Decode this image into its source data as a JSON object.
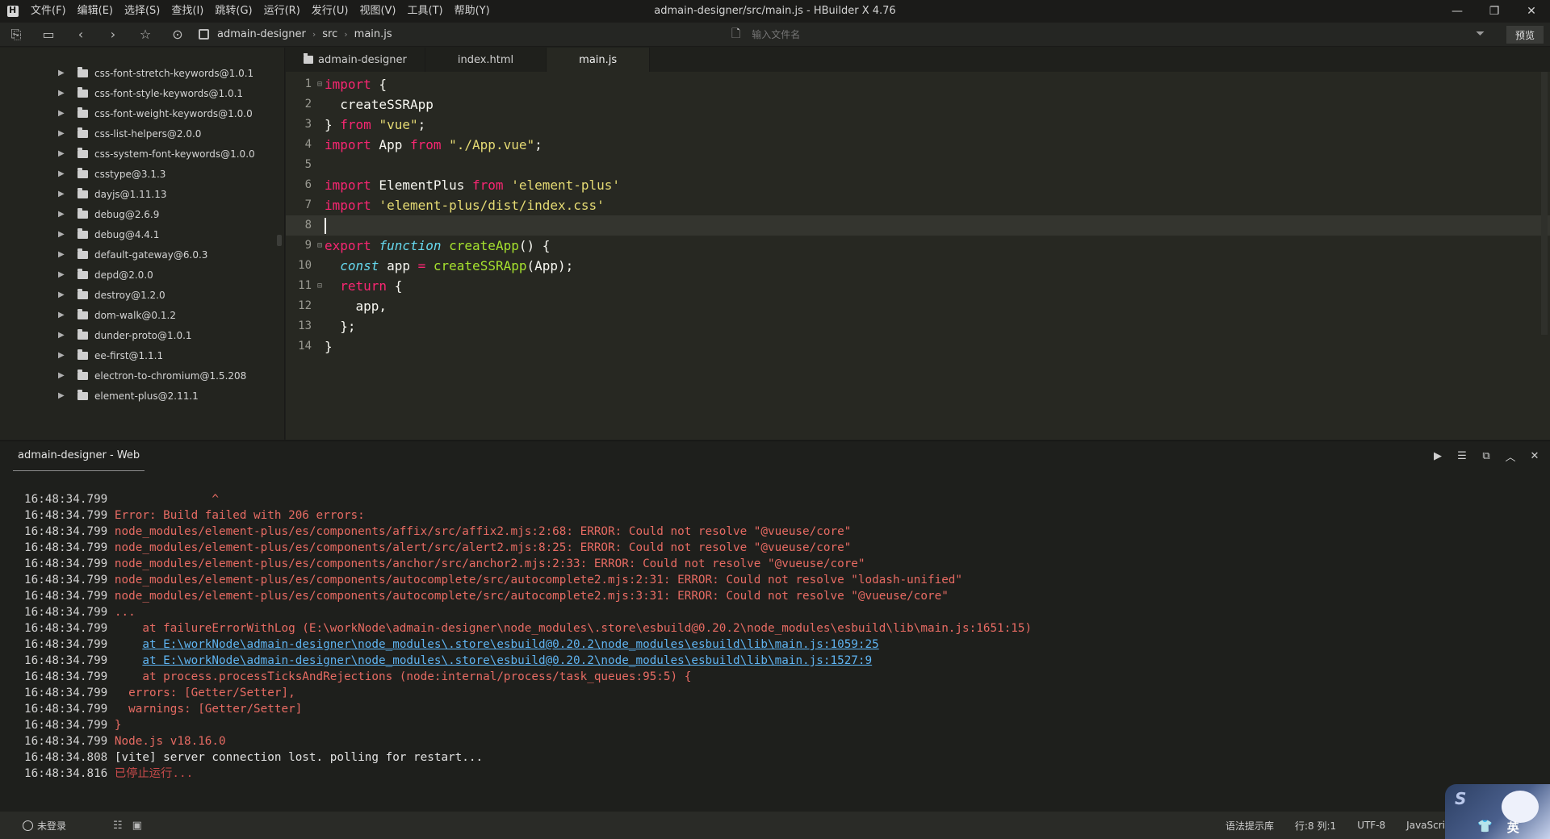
{
  "window": {
    "title": "admain-designer/src/main.js - HBuilder X 4.76",
    "menu": [
      "文件(F)",
      "编辑(E)",
      "选择(S)",
      "查找(I)",
      "跳转(G)",
      "运行(R)",
      "发行(U)",
      "视图(V)",
      "工具(T)",
      "帮助(Y)"
    ],
    "minimize": "—",
    "restore": "❐",
    "close": "✕"
  },
  "toolbar": {
    "breadcrumb": [
      "admain-designer",
      "src",
      "main.js"
    ],
    "search_placeholder": "输入文件名",
    "preview_label": "预览"
  },
  "sidebar": {
    "items": [
      "css-font-stretch-keywords@1.0.1",
      "css-font-style-keywords@1.0.1",
      "css-font-weight-keywords@1.0.0",
      "css-list-helpers@2.0.0",
      "css-system-font-keywords@1.0.0",
      "csstype@3.1.3",
      "dayjs@1.11.13",
      "debug@2.6.9",
      "debug@4.4.1",
      "default-gateway@6.0.3",
      "depd@2.0.0",
      "destroy@1.2.0",
      "dom-walk@0.1.2",
      "dunder-proto@1.0.1",
      "ee-first@1.1.1",
      "electron-to-chromium@1.5.208",
      "element-plus@2.11.1"
    ]
  },
  "tabs": [
    "admain-designer",
    "index.html",
    "main.js"
  ],
  "editor": {
    "line_numbers": [
      "1",
      "2",
      "3",
      "4",
      "5",
      "6",
      "7",
      "8",
      "9",
      "10",
      "11",
      "12",
      "13",
      "14"
    ]
  },
  "console": {
    "tab_label": "admain-designer - Web",
    "caret_line": "              ^",
    "timestamps": [
      "16:48:34.799",
      "16:48:34.799",
      "16:48:34.799",
      "16:48:34.799",
      "16:48:34.799",
      "16:48:34.799",
      "16:48:34.799",
      "16:48:34.799",
      "16:48:34.799",
      "16:48:34.799",
      "16:48:34.799",
      "16:48:34.799",
      "16:48:34.799",
      "16:48:34.799",
      "16:48:34.799",
      "16:48:34.799",
      "16:48:34.808",
      "16:48:34.816"
    ],
    "lines": [
      "Error: Build failed with 206 errors:",
      "node_modules/element-plus/es/components/affix/src/affix2.mjs:2:68: ERROR: Could not resolve \"@vueuse/core\"",
      "node_modules/element-plus/es/components/alert/src/alert2.mjs:8:25: ERROR: Could not resolve \"@vueuse/core\"",
      "node_modules/element-plus/es/components/anchor/src/anchor2.mjs:2:33: ERROR: Could not resolve \"@vueuse/core\"",
      "node_modules/element-plus/es/components/autocomplete/src/autocomplete2.mjs:2:31: ERROR: Could not resolve \"lodash-unified\"",
      "node_modules/element-plus/es/components/autocomplete/src/autocomplete2.mjs:3:31: ERROR: Could not resolve \"@vueuse/core\"",
      "...",
      "    at failureErrorWithLog (E:\\workNode\\admain-designer\\node_modules\\.store\\esbuild@0.20.2\\node_modules\\esbuild\\lib\\main.js:1651:15)",
      "at E:\\workNode\\admain-designer\\node_modules\\.store\\esbuild@0.20.2\\node_modules\\esbuild\\lib\\main.js:1059:25",
      "at E:\\workNode\\admain-designer\\node_modules\\.store\\esbuild@0.20.2\\node_modules\\esbuild\\lib\\main.js:1527:9",
      "    at process.processTicksAndRejections (node:internal/process/task_queues:95:5) {",
      "  errors: [Getter/Setter],",
      "  warnings: [Getter/Setter]",
      "}",
      "Node.js v18.16.0",
      "[vite] server connection lost. polling for restart...",
      "已停止运行..."
    ]
  },
  "status": {
    "login": "未登录",
    "syntax": "语法提示库",
    "position": "行:8  列:1",
    "encoding": "UTF-8",
    "language": "JavaScript",
    "ime_skin": "👕",
    "ime_lang": "英"
  },
  "colors": {
    "keyword": "#f92672",
    "string": "#e6db74",
    "function": "#a6e22e",
    "error": "#e76b63",
    "link": "#5fb4f2"
  }
}
